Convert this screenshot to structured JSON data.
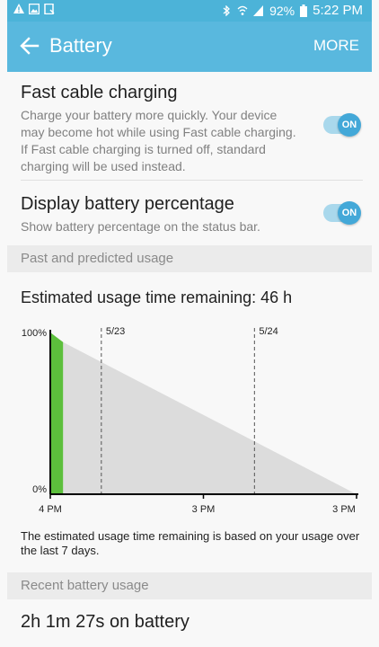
{
  "status_bar": {
    "left_icons": [
      "warning-icon",
      "gallery-icon",
      "screenshot-icon"
    ],
    "right_icons": [
      "bluetooth-icon",
      "wifi-icon",
      "signal-icon",
      "battery-icon"
    ],
    "battery": "92%",
    "time": "5:22 PM"
  },
  "header": {
    "title": "Battery",
    "more": "MORE"
  },
  "settings": {
    "fast_charging": {
      "title": "Fast cable charging",
      "description": "Charge your battery more quickly. Your device may become hot while using Fast cable charging. If Fast cable charging is turned off, standard charging will be used instead.",
      "toggle": "ON"
    },
    "battery_percentage": {
      "title": "Display battery percentage",
      "description": "Show battery percentage on the status bar.",
      "toggle": "ON"
    }
  },
  "usage": {
    "section_label": "Past and predicted usage",
    "estimate": "Estimated usage time remaining: 46 h",
    "note": "The estimated usage time remaining is based on your usage over the last 7 days."
  },
  "chart_data": {
    "type": "area",
    "y_ticks": [
      "100%",
      "0%"
    ],
    "x_ticks": [
      "4 PM",
      "3 PM",
      "3 PM"
    ],
    "date_markers": [
      "5/23",
      "5/24"
    ],
    "past_usage": [
      [
        0,
        100
      ],
      [
        1,
        97
      ],
      [
        2,
        94
      ]
    ],
    "predicted_usage": [
      [
        2,
        94
      ],
      [
        48,
        0
      ]
    ],
    "ylim": [
      0,
      100
    ],
    "colors": {
      "past": "#5cbf3c",
      "predicted": "#dcdcdc",
      "axis": "#000000"
    }
  },
  "recent": {
    "section_label": "Recent battery usage",
    "value": "2h 1m 27s on battery"
  }
}
